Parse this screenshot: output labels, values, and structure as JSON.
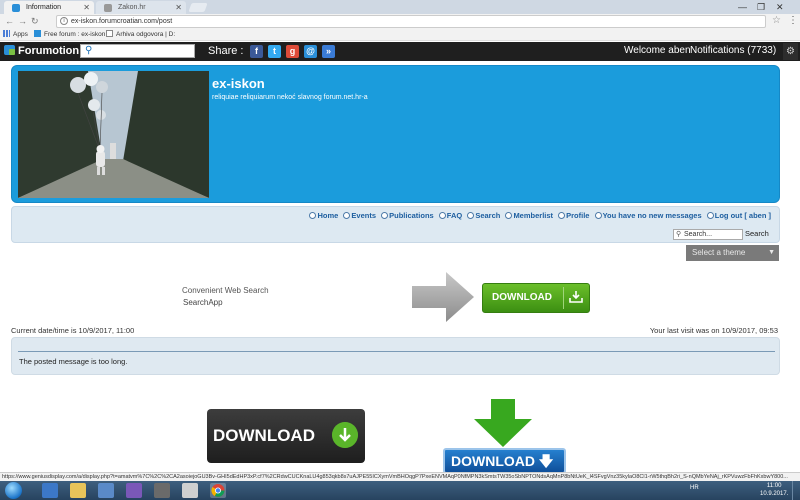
{
  "browser": {
    "tabs": [
      {
        "label": "Information",
        "active": true
      },
      {
        "label": "Zakon.hr",
        "active": false
      }
    ],
    "url": "ex-iskon.forumcroatian.com/post",
    "bookmarks": [
      "Apps",
      "Free forum : ex-iskon",
      "Arhiva odgovora | D:"
    ],
    "status_url": "https://www.geniusdisplay.com/a/display.php?t=amatvm%7C%2C%2CA2asoiejoGU3Bv-GHI5dEdHP3xP.cf7%2CRdwCUCKnaLU4g853qkb8s7uAJPE55ICXymVmBHOqgP7PxeENVMAqP0NfMPN3kSmtsTW35oSbNPTONdsAqMnP8bNtUeK_l4SFvgVnz35kylaO8Cl1-rW5thqBh2ri_S-nQMbYeNAj_rKPVuwzFbFhKxbwY800..."
  },
  "forumotion_bar": {
    "logo": "Forumotion",
    "share_label": "Share :",
    "welcome": "Welcome aben",
    "notifications": "Notifications",
    "notifications_count": "(7733)"
  },
  "header": {
    "title": "ex-iskon",
    "subtitle": "reliquiae reliquiarum nekoć slavnog forum.net.hr-a"
  },
  "nav": {
    "links": [
      "Home",
      "Events",
      "Publications",
      "FAQ",
      "Search",
      "Memberlist",
      "Profile",
      "You have no new messages",
      "Log out [ aben ]"
    ],
    "search_placeholder": "Search...",
    "search_button": "Search"
  },
  "theme_select": "Select a theme",
  "ad": {
    "line1": "Convenient Web Search",
    "line2": "SearchApp",
    "download_label": "DOWNLOAD"
  },
  "times": {
    "current": "Current date/time is 10/9/2017, 11:00",
    "last_visit": "Your last visit was on 10/9/2017, 09:53"
  },
  "message": "The posted message is too long.",
  "ads_bottom": {
    "dark_label": "DOWNLOAD",
    "blue_label": "DOWNLOAD"
  },
  "taskbar": {
    "lang": "HR",
    "time": "11:00",
    "date": "10.9.2017."
  },
  "colors": {
    "header_blue": "#1b9cdc",
    "forumotion_bar": "#1f1f1f",
    "download_green": "#4fa21c",
    "nav_bg": "#dde9f2"
  }
}
